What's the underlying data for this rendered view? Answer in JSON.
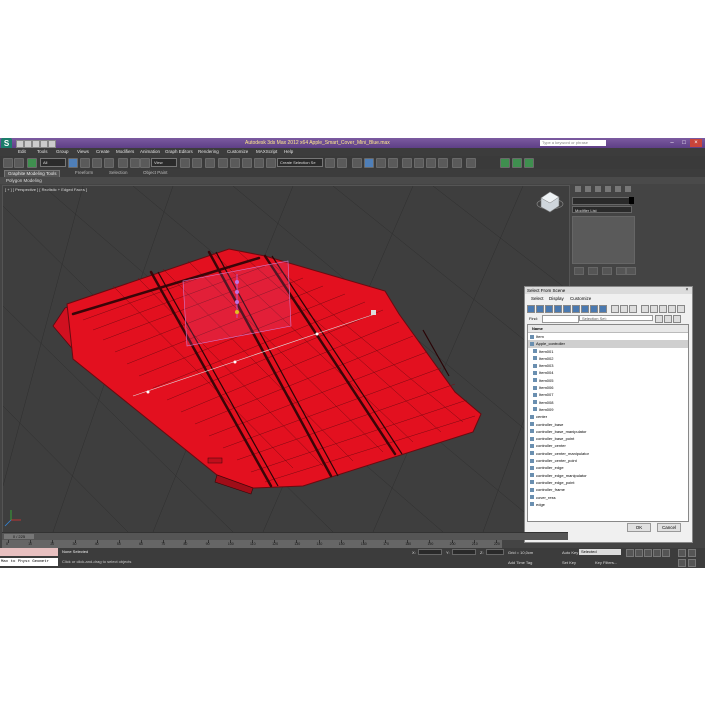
{
  "window": {
    "logo": "S",
    "title": "Autodesk 3ds Max 2012 x64     Apple_Smart_Cover_Mini_Blue.max",
    "search_placeholder": "Type a keyword or phrase",
    "minimize": "–",
    "maximize": "□",
    "close": "×"
  },
  "menu": [
    "Edit",
    "Tools",
    "Group",
    "Views",
    "Create",
    "Modifiers",
    "Animation",
    "Graph Editors",
    "Rendering",
    "Customize",
    "MAXScript",
    "Help"
  ],
  "toolbar": {
    "filter": "All",
    "view": "View",
    "selection_set": "Create Selection Se"
  },
  "ribbon": {
    "tabs": [
      "Graphite Modeling Tools",
      "Freeform",
      "Selection",
      "Object Paint"
    ],
    "sub_label": "Polygon Modeling"
  },
  "viewport": {
    "label": "[ + ] [ Perspective ] [ Realistic + Edged Faces ]",
    "object_color": "#e30f1f",
    "wire_color": "#6a0a10",
    "background": "#3e3e3e"
  },
  "command_panel": {
    "modifier_list": "Modifier List"
  },
  "select_dialog": {
    "title": "Select From Scene",
    "menu": [
      "Select",
      "Display",
      "Customize"
    ],
    "find_label": "Find:",
    "selection_set": "Selection Set:",
    "column_header": "Name",
    "items": [
      {
        "name": "Item"
      },
      {
        "name": "Apple_controller"
      },
      {
        "name": "Item001"
      },
      {
        "name": "Item002"
      },
      {
        "name": "Item003"
      },
      {
        "name": "Item004"
      },
      {
        "name": "Item005"
      },
      {
        "name": "Item006"
      },
      {
        "name": "Item007"
      },
      {
        "name": "Item008"
      },
      {
        "name": "Item009"
      },
      {
        "name": "center"
      },
      {
        "name": "controller_base"
      },
      {
        "name": "controller_base_manipulator"
      },
      {
        "name": "controller_base_point"
      },
      {
        "name": "controller_center"
      },
      {
        "name": "controller_center_manipulator"
      },
      {
        "name": "controller_center_point"
      },
      {
        "name": "controller_edge"
      },
      {
        "name": "controller_edge_manipulator"
      },
      {
        "name": "controller_edge_point"
      },
      {
        "name": "controller_frame"
      },
      {
        "name": "cover_ress"
      },
      {
        "name": "edge"
      }
    ],
    "ok": "OK",
    "cancel": "Cancel"
  },
  "timeline": {
    "slider": "0 / 225",
    "ticks": [
      "0",
      "10",
      "20",
      "30",
      "40",
      "50",
      "60",
      "70",
      "80",
      "90",
      "100",
      "110",
      "120",
      "130",
      "140",
      "150",
      "160",
      "170",
      "180",
      "190",
      "200",
      "210",
      "220"
    ]
  },
  "status": {
    "listener": "Max to Physx Geometr",
    "selected": "None Selected",
    "prompt": "Click or click-and-drag to select objects",
    "x": "X:",
    "y": "Y:",
    "z": "Z:",
    "grid": "Grid = 10,0cm",
    "add_time_tag": "Add Time Tag",
    "auto_key": "Auto Key",
    "auto_key_value": "Selected",
    "set_key": "Set Key",
    "key_filters": "Key Filters..."
  }
}
